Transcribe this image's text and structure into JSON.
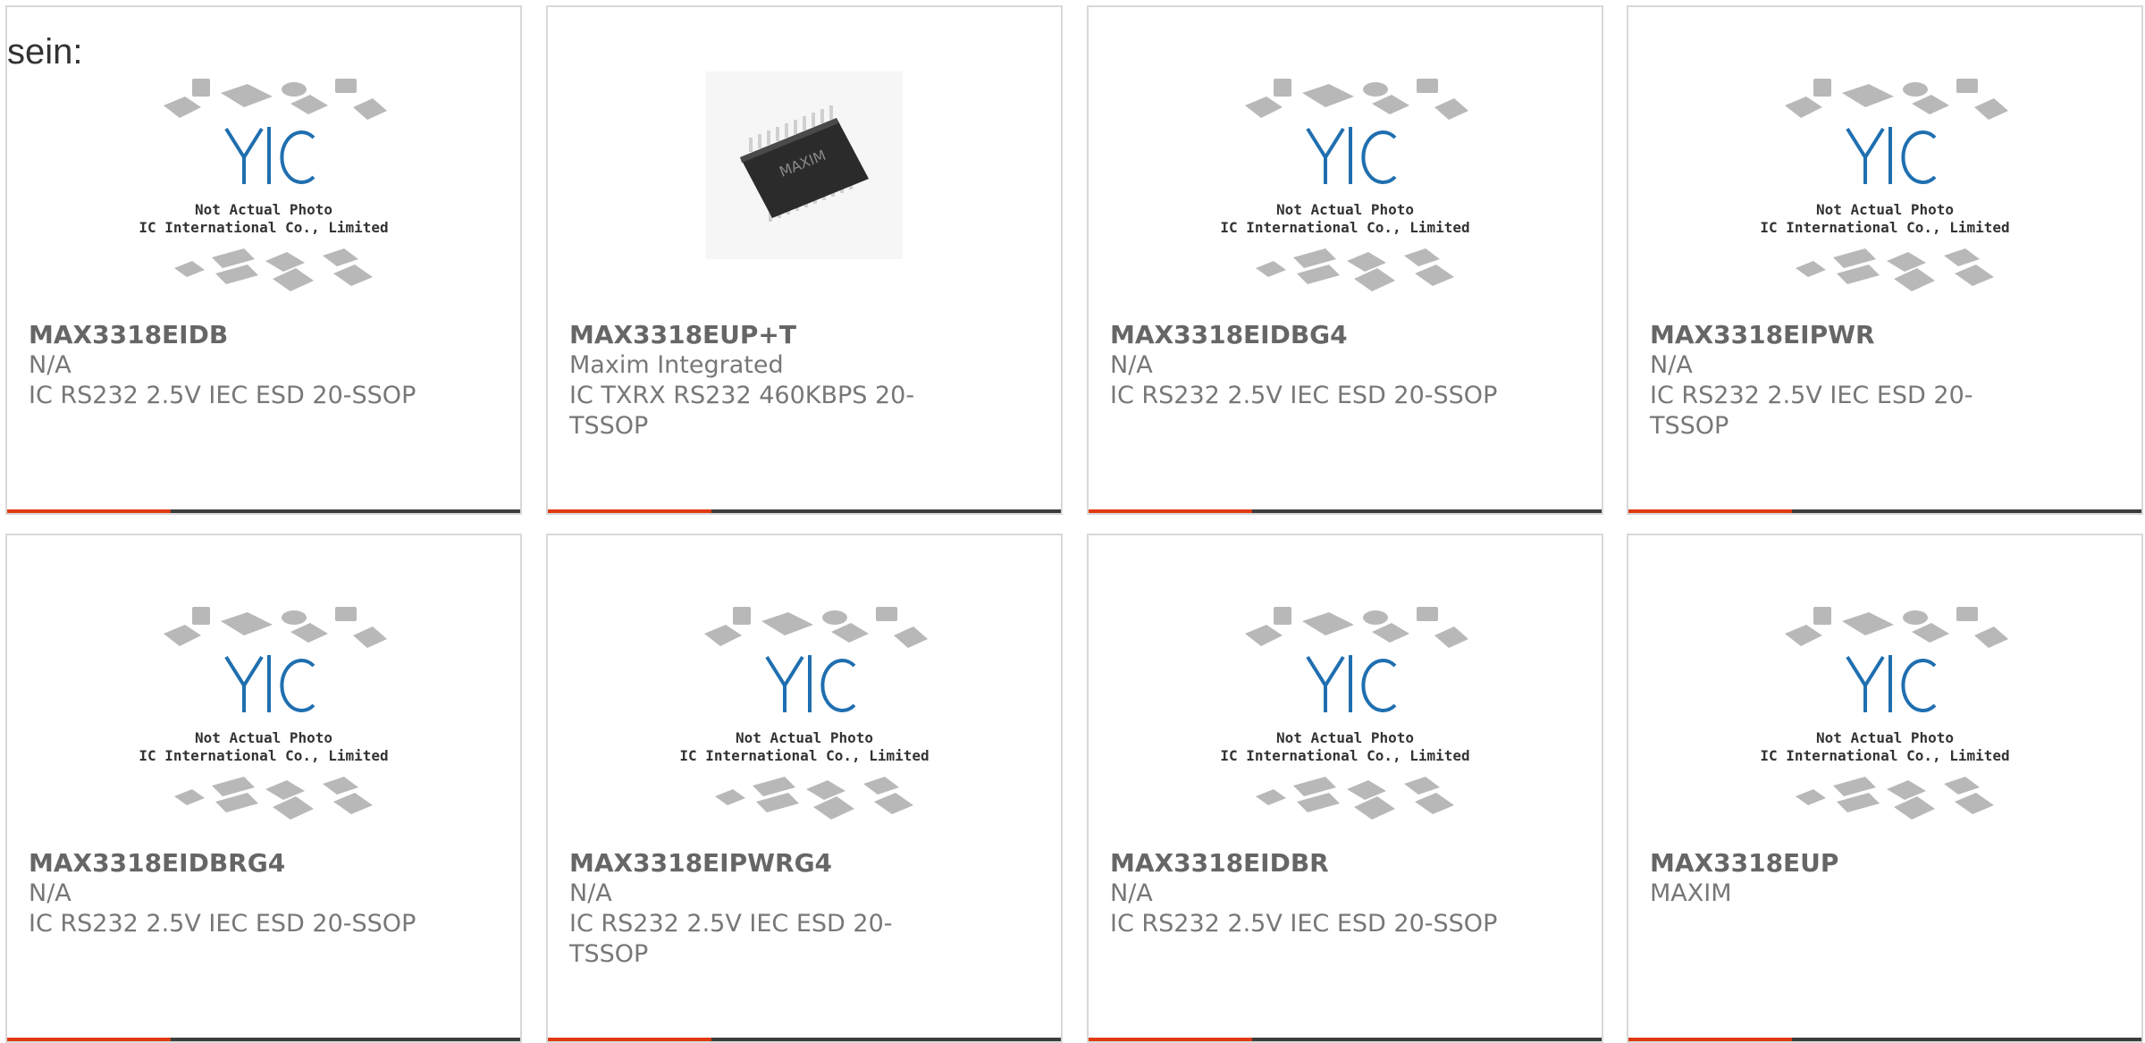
{
  "heading": "sein:",
  "placeholder_image": {
    "line1": "Not Actual Photo",
    "line2": "YIC International Co., Limited.",
    "logo_text": "YIC"
  },
  "chip_image": {
    "marking": "MAXIM"
  },
  "colors": {
    "accent": "#e03a13",
    "bar": "#3d3d3d",
    "logo_blue": "#1f6fb0"
  },
  "products": [
    {
      "part": "MAX3318EIDB",
      "manufacturer": "N/A",
      "description": "IC RS232 2.5V IEC ESD 20-SSOP",
      "image": "placeholder"
    },
    {
      "part": "MAX3318EUP+T",
      "manufacturer": "Maxim Integrated",
      "description": "IC TXRX RS232 460KBPS 20-TSSOP",
      "image": "chip"
    },
    {
      "part": "MAX3318EIDBG4",
      "manufacturer": "N/A",
      "description": "IC RS232 2.5V IEC ESD 20-SSOP",
      "image": "placeholder"
    },
    {
      "part": "MAX3318EIPWR",
      "manufacturer": "N/A",
      "description": "IC RS232 2.5V IEC ESD 20-TSSOP",
      "image": "placeholder"
    },
    {
      "part": "MAX3318EIDBRG4",
      "manufacturer": "N/A",
      "description": "IC RS232 2.5V IEC ESD 20-SSOP",
      "image": "placeholder"
    },
    {
      "part": "MAX3318EIPWRG4",
      "manufacturer": "N/A",
      "description": "IC RS232 2.5V IEC ESD 20-TSSOP",
      "image": "placeholder"
    },
    {
      "part": "MAX3318EIDBR",
      "manufacturer": "N/A",
      "description": "IC RS232 2.5V IEC ESD 20-SSOP",
      "image": "placeholder"
    },
    {
      "part": "MAX3318EUP",
      "manufacturer": "MAXIM",
      "description": "",
      "image": "placeholder"
    }
  ]
}
